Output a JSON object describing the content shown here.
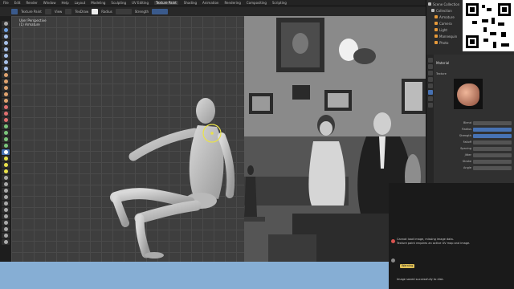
{
  "menubar": {
    "items": [
      "File",
      "Edit",
      "Render",
      "Window",
      "Help",
      "Layout",
      "Modeling",
      "Sculpting",
      "UV Editing",
      "Texture Paint",
      "Shading",
      "Animation",
      "Rendering",
      "Compositing",
      "Scripting"
    ],
    "active_index": 9
  },
  "toolbar": {
    "mode_label": "Texture Paint",
    "view_label": "View",
    "brush_label": "TexDraw",
    "radius_label": "Radius",
    "strength_label": "Strength"
  },
  "viewport": {
    "title_line1": "User Perspective",
    "title_line2": "(1) Armature"
  },
  "outliner": {
    "rows": [
      "Scene Collection",
      "Collection",
      "Armature",
      "Camera",
      "Light",
      "Mannequin",
      "Photo"
    ]
  },
  "properties": {
    "header": "Material",
    "texture_label": "Texture",
    "rows": [
      {
        "label": "Blend",
        "value": "Mix"
      },
      {
        "label": "Radius",
        "value": "50 px"
      },
      {
        "label": "Strength",
        "value": "1.000"
      },
      {
        "label": "Falloff",
        "value": "Smooth"
      },
      {
        "label": "Spacing",
        "value": "10%"
      },
      {
        "label": "Jitter",
        "value": "0.000"
      },
      {
        "label": "Stroke",
        "value": "Space"
      },
      {
        "label": "Angle",
        "value": "0°"
      }
    ]
  },
  "notification": {
    "line1": "Cannot load image, missing image data.",
    "line2": "Texture paint requires an active UV map and image.",
    "chip": "Warning",
    "line3": "Image saved successfully to disk."
  },
  "colors": {
    "accent": "#4772b3",
    "bottom_band": "#86aed4",
    "warning": "#d9534f",
    "highlight_yellow": "#e2c256"
  },
  "icons": [
    "pointer-icon",
    "brush-icon",
    "fill-icon",
    "mask-icon",
    "eye-icon",
    "camera-icon",
    "material-icon",
    "qr-code-icon"
  ]
}
